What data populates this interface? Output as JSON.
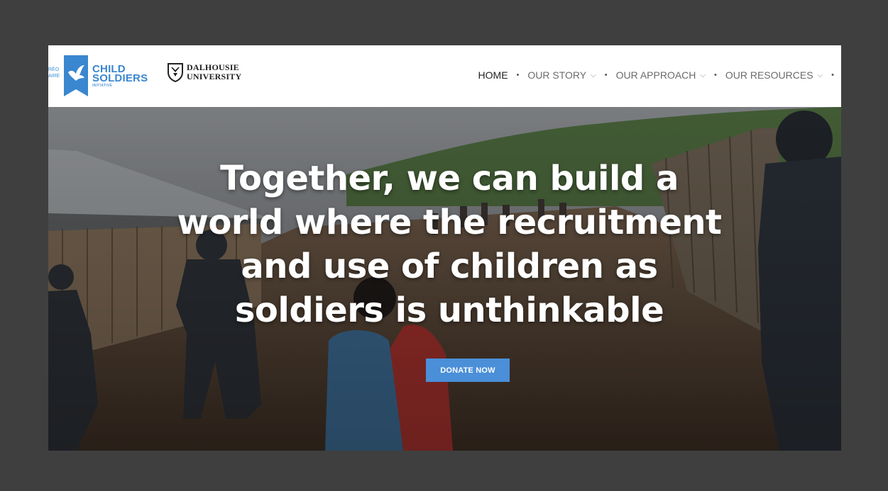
{
  "header": {
    "cutoff_logo_text": [
      "RÉO",
      "AIRE"
    ],
    "csi_logo": {
      "line1": "CHILD",
      "line2": "SOLDIERS",
      "line3": "INITIATIVE"
    },
    "dal_logo": {
      "line1": "DALHOUSIE",
      "line2": "UNIVERSITY"
    },
    "nav": [
      {
        "label": "HOME",
        "has_dropdown": false,
        "active": true
      },
      {
        "label": "OUR STORY",
        "has_dropdown": true,
        "active": false
      },
      {
        "label": "OUR APPROACH",
        "has_dropdown": true,
        "active": false
      },
      {
        "label": "OUR RESOURCES",
        "has_dropdown": true,
        "active": false
      }
    ],
    "separator": "•",
    "chevron": "⌵"
  },
  "hero": {
    "headline_lines": [
      "Together, we can build a",
      "world where the recruitment",
      "and use of children as",
      "soldiers is unthinkable"
    ],
    "donate_label": "DONATE NOW"
  },
  "colors": {
    "accent": "#4a8fd8",
    "page_bg": "#3f3f3f",
    "nav_text": "#6b6b6b",
    "nav_active": "#222222"
  }
}
